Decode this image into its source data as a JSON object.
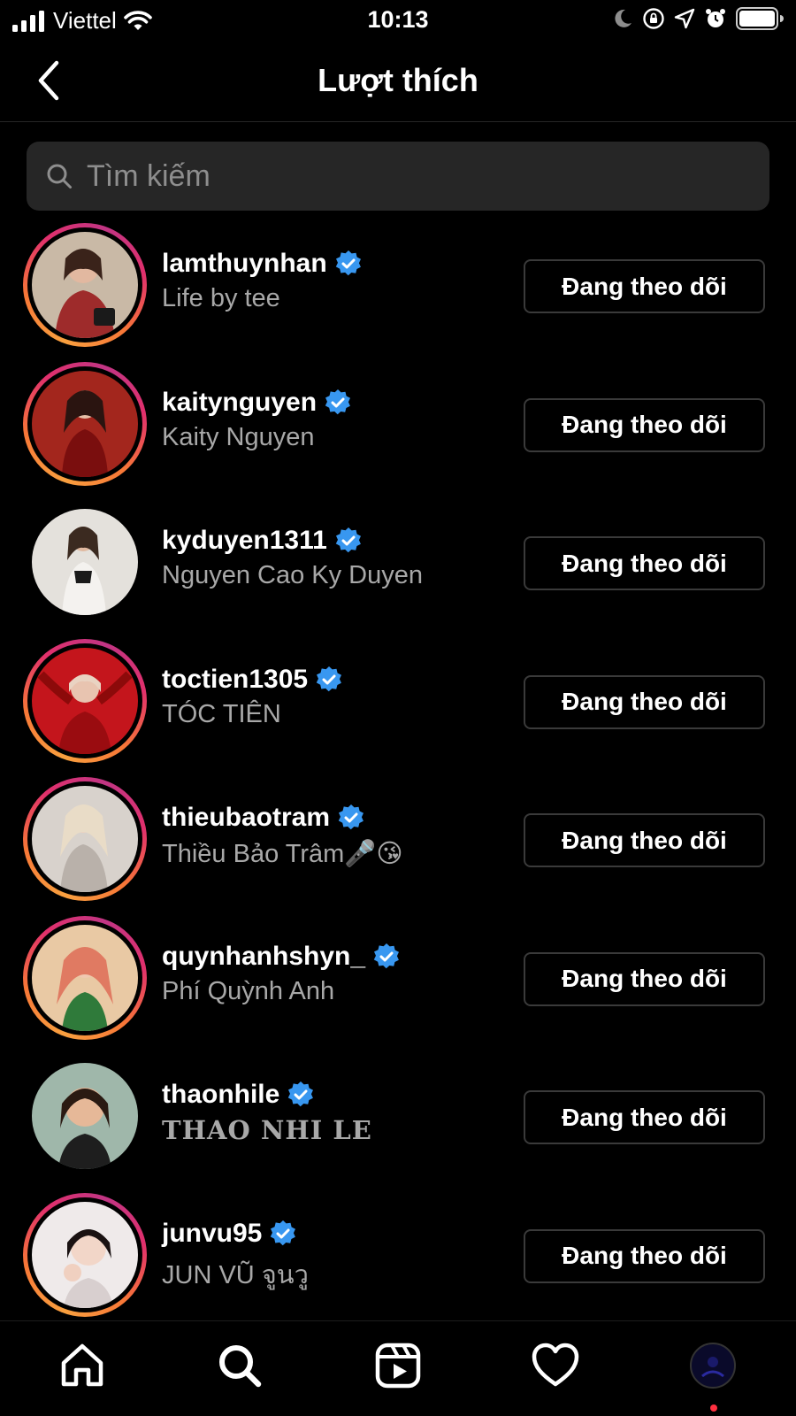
{
  "status_bar": {
    "carrier": "Viettel",
    "time": "10:13",
    "icons": [
      "signal-icon",
      "wifi-icon",
      "moon-icon",
      "rotation-lock-icon",
      "location-icon",
      "alarm-icon",
      "battery-icon"
    ]
  },
  "header": {
    "title": "Lượt thích",
    "back_icon": "chevron-left-icon"
  },
  "search": {
    "placeholder": "Tìm kiếm",
    "value": ""
  },
  "users": [
    {
      "username": "lamthuynhan",
      "full_name": "Life by tee",
      "verified": true,
      "story_ring": true,
      "button": "Đang theo dõi",
      "avatar_color": "#9e2b2b"
    },
    {
      "username": "kaitynguyen",
      "full_name": "Kaity Nguyen",
      "verified": true,
      "story_ring": true,
      "button": "Đang theo dõi",
      "avatar_color": "#a3261d"
    },
    {
      "username": "kyduyen1311",
      "full_name": "Nguyen Cao Ky Duyen",
      "verified": true,
      "story_ring": false,
      "button": "Đang theo dõi",
      "avatar_color": "#d9d6d1"
    },
    {
      "username": "toctien1305",
      "full_name": "TÓC TIÊN",
      "verified": true,
      "story_ring": true,
      "button": "Đang theo dõi",
      "avatar_color": "#c4151c"
    },
    {
      "username": "thieubaotram",
      "full_name": "Thiều Bảo Trâm🎤😘",
      "verified": true,
      "story_ring": true,
      "button": "Đang theo dõi",
      "avatar_color": "#cfc8c2"
    },
    {
      "username": "quynhanhshyn_",
      "full_name": "Phí Quỳnh Anh",
      "verified": true,
      "story_ring": true,
      "button": "Đang theo dõi",
      "avatar_color": "#d98a6a"
    },
    {
      "username": "thaonhile",
      "full_name": "𝐓𝐇𝐀𝐎 𝐍𝐇𝐈 𝐋𝐄",
      "verified": true,
      "story_ring": false,
      "button": "Đang theo dõi",
      "avatar_color": "#8fa89a"
    },
    {
      "username": "junvu95",
      "full_name": "JUN VŨ จูนวู",
      "verified": true,
      "story_ring": true,
      "button": "Đang theo dõi",
      "avatar_color": "#e8e4e6"
    }
  ],
  "bottom_nav": {
    "items": [
      "home-icon",
      "search-icon",
      "reels-icon",
      "heart-icon",
      "profile-avatar"
    ],
    "has_notification_dot": true
  }
}
